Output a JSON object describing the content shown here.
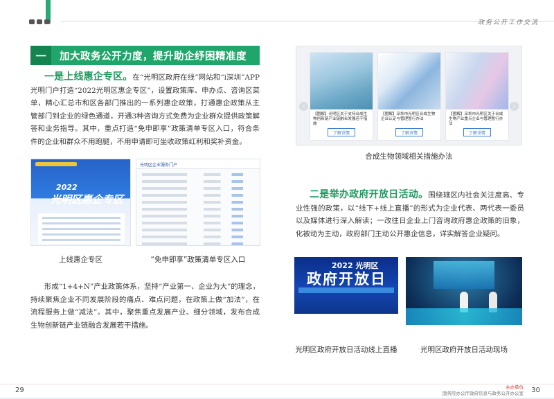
{
  "header": {
    "right_text": "政务公开工作交流"
  },
  "section": {
    "number": "一",
    "title": "加大政务公开力度，提升助企纾困精准度"
  },
  "para1": {
    "highlight": "一是上线惠企专区。",
    "text": "在“光明区政府在线”网站和“i深圳”APP光明门户打造“2022光明区惠企专区”，设置政策库、申办点、咨询区菜单，精心汇总市和区各部门推出的一系列惠企政策，打通惠企政策从主管部门到企业的绿色通道，开通3种咨询方式免费为企业群众提供政策解答和业务指导。其中，重点打造“免申即享”政策清单专区入口，符合条件的企业和群众不用跑腿，不用申请即可坐收政策红利和奖补资金。"
  },
  "shot_a": {
    "title_line1": "2022",
    "title_line2": "光明区惠企专区"
  },
  "shot_b": {
    "header": "光明区企业服务门户"
  },
  "captions": {
    "shot_a": "上线惠企专区",
    "shot_b": "“免申即享”政策清单专区入口",
    "carousel": "合成生物领域相关措施办法",
    "photo1": "光明区政府开放日活动线上直播",
    "photo2": "光明区政府开放日活动现场"
  },
  "para2": {
    "text": "形成“1+4+N”产业政策体系，坚持“产业第一、企业为大”的理念，持续聚焦企业不同发展阶段的痛点、难点问题，在政策上做“加法”，在流程服务上做“减法”。其中，聚焦重点发展产业、细分领域，发布合成生物创新链产业链融合发展若干措施。"
  },
  "carousel": {
    "prev_icon": "‹",
    "next_icon": "›",
    "cards": [
      {
        "title": "【图解】光明区关于支持合成生物创新链产业链融合发展若干措施",
        "button": "了解详情"
      },
      {
        "title": "【图解】深圳市光明区合成生物企业认定与管理暂行办法",
        "button": "了解详情"
      },
      {
        "title": "【图解】深圳市光明区关于合成生物产业重点企业与管理暂行办法",
        "button": "了解详情"
      }
    ]
  },
  "para3": {
    "highlight": "二是举办政府开放日活动。",
    "text": "围绕辖区内社会关注度高、专业性强的政策，以“线下+线上直播”的形式为企业代表、两代表一委员以及媒体进行深入解读；一改往日企业上门咨询政府惠企政策的旧象，化被动为主动，政府部门主动公开惠企信息，详实解答企业疑问。"
  },
  "photo1": {
    "line1": "2022 光明区",
    "line2": "政府开放日"
  },
  "footer": {
    "page_left": "29",
    "page_right": "30",
    "org_line1": "主办单位",
    "org_line2": "国务院办公厅政府信息与政务公开办公室"
  }
}
